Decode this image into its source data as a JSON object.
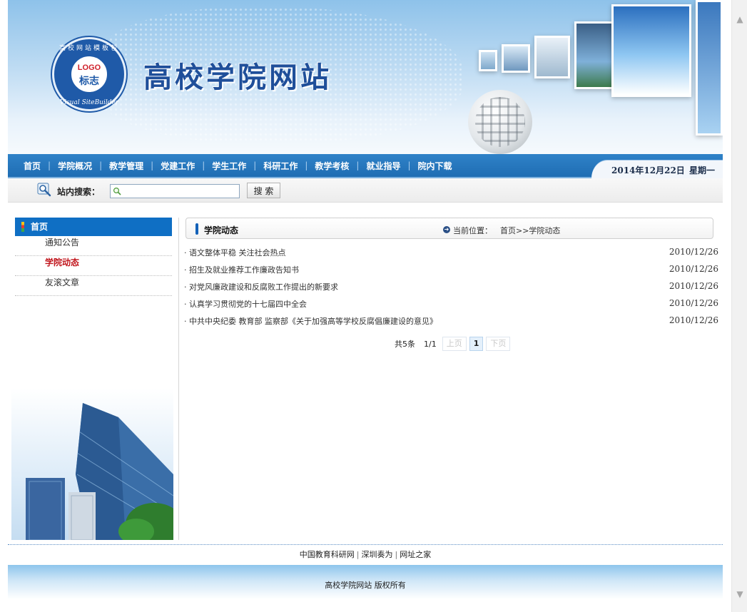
{
  "header": {
    "site_title": "高校学院网站",
    "logo_text": "LOGO",
    "logo_sub": "标志",
    "logo_ring_top": "高校网站模板包",
    "logo_ring_bottom": "Visual SiteBuilder"
  },
  "nav": {
    "items": [
      {
        "label": "首页"
      },
      {
        "label": "学院概况"
      },
      {
        "label": "教学管理"
      },
      {
        "label": "党建工作"
      },
      {
        "label": "学生工作"
      },
      {
        "label": "科研工作"
      },
      {
        "label": "教学考核"
      },
      {
        "label": "就业指导"
      },
      {
        "label": "院内下载"
      }
    ],
    "separator": "|",
    "date": "2014年12月22日",
    "weekday": "星期一"
  },
  "search": {
    "label": "站内搜索：",
    "input_value": "",
    "button_label": "搜 索"
  },
  "sidebar": {
    "heading": "首页",
    "items": [
      {
        "label": "通知公告",
        "active": false
      },
      {
        "label": "学院动态",
        "active": true
      },
      {
        "label": "友滚文章",
        "active": false
      }
    ]
  },
  "main": {
    "section_title": "学院动态",
    "location_label": "当前位置：",
    "location_path": "首页>>学院动态",
    "news": [
      {
        "title": "· 语文整体平稳 关注社会热点",
        "date": "2010/12/26"
      },
      {
        "title": "· 招生及就业推荐工作廉政告知书",
        "date": "2010/12/26"
      },
      {
        "title": "· 对党风廉政建设和反腐败工作提出的新要求",
        "date": "2010/12/26"
      },
      {
        "title": "· 认真学习贯彻党的十七届四中全会",
        "date": "2010/12/26"
      },
      {
        "title": "· 中共中央纪委 教育部 监察部《关于加强高等学校反腐倡廉建设的意见》",
        "date": "2010/12/26"
      }
    ],
    "pager": {
      "total": "共5条",
      "page_info": "1/1",
      "prev": "上页",
      "current": "1",
      "next": "下页"
    }
  },
  "footer": {
    "links": [
      "中国教育科研网",
      "深圳奏为",
      "网址之家"
    ],
    "link_separator": "|",
    "copyright": "高校学院网站 版权所有"
  },
  "colors": {
    "nav_blue": "#1f6db3",
    "sidebar_head": "#0f6fc4",
    "active_red": "#c0141b",
    "title_blue": "#1f4f9a"
  },
  "icons": {
    "scroll_up": "▲",
    "scroll_down": "▼",
    "location_arrow": "➜"
  }
}
